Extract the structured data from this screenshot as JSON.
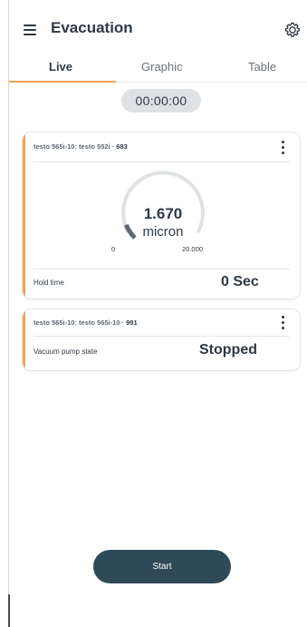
{
  "header": {
    "title": "Evacuation",
    "menu_icon": "menu-icon",
    "settings_icon": "gear-icon"
  },
  "tabs": [
    {
      "label": "Live",
      "active": true
    },
    {
      "label": "Graphic",
      "active": false
    },
    {
      "label": "Table",
      "active": false
    }
  ],
  "timer": "00:00:00",
  "colors": {
    "accent": "#f0a554",
    "primary_button": "#2e4a56",
    "text": "#2f3a44",
    "gauge_track": "#dfe2e4"
  },
  "cards": [
    {
      "title_prefix": "testo 565i-10: testo 552i · ",
      "serial": "683",
      "gauge": {
        "value": "1.670",
        "unit": "micron",
        "min_label": "0",
        "max_label": "20.000",
        "fill_fraction": 0.0835
      },
      "row_label": "Hold time",
      "row_value": "0 Sec"
    },
    {
      "title_prefix": "testo 565i-10: testo 565i-10 · ",
      "serial": "991",
      "row_label": "Vacuum pump state",
      "row_value": "Stopped"
    }
  ],
  "start_button": {
    "label": "Start"
  }
}
